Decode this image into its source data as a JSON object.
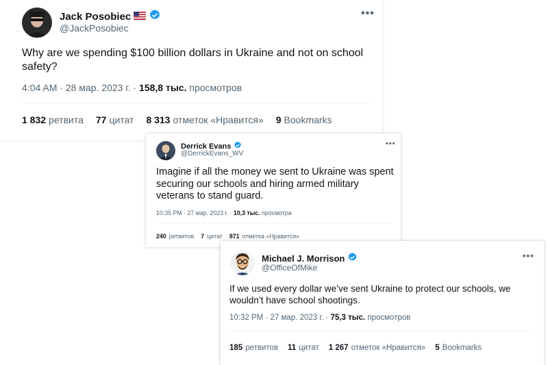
{
  "tweets": [
    {
      "display_name": "Jack Posobiec",
      "has_flag": true,
      "handle": "@JackPosobiec",
      "text": "Why are we spending $100 billion dollars in Ukraine and not on school safety?",
      "time": "4:04 AM",
      "date": "28 мар. 2023 г.",
      "views_count": "158,8 тыс.",
      "views_label": "просмотров",
      "stats": [
        {
          "count": "1 832",
          "label": "ретвита"
        },
        {
          "count": "77",
          "label": "цитат"
        },
        {
          "count": "8 313",
          "label": "отметок «Нравится»"
        },
        {
          "count": "9",
          "label": "Bookmarks"
        }
      ]
    },
    {
      "display_name": "Derrick Evans",
      "has_flag": false,
      "handle": "@DerrickEvans_WV",
      "text": "Imagine if all the money we sent to Ukraine was spent securing our schools and hiring armed military veterans to stand guard.",
      "time": "10:35 PM",
      "date": "27 мар. 2023 г.",
      "views_count": "10,3 тыс.",
      "views_label": "просмотра",
      "stats": [
        {
          "count": "240",
          "label": "ретвитов"
        },
        {
          "count": "7",
          "label": "цитат"
        },
        {
          "count": "871",
          "label": "отметка «Нравится»"
        }
      ]
    },
    {
      "display_name": "Michael J. Morrison",
      "has_flag": false,
      "handle": "@OfficeOfMike",
      "text": "If we used every dollar we’ve sent Ukraine to protect our schools, we wouldn’t have school shootings.",
      "time": "10:32 PM",
      "date": "27 мар. 2023 г.",
      "views_count": "75,3 тыс.",
      "views_label": "просмотров",
      "stats": [
        {
          "count": "185",
          "label": "ретвитов"
        },
        {
          "count": "11",
          "label": "цитат"
        },
        {
          "count": "1 267",
          "label": "отметок «Нравится»"
        },
        {
          "count": "5",
          "label": "Bookmarks"
        }
      ]
    }
  ],
  "icons": {
    "more": "more-horizontal-icon",
    "verified": "verified-badge-icon",
    "flag": "us-flag-icon"
  },
  "colors": {
    "verified": "#1d9bf0",
    "secondary_text": "#536471",
    "primary_text": "#0f1419"
  }
}
